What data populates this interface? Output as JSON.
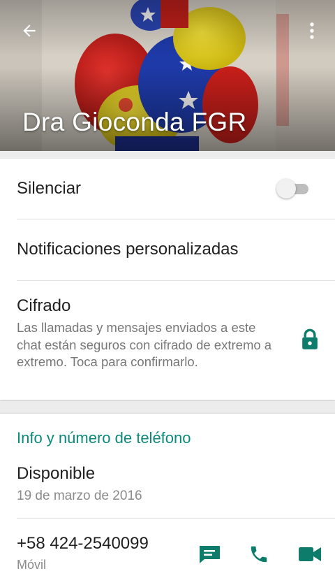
{
  "header": {
    "contact_name": "Dra Gioconda FGR",
    "back_icon": "arrow-back-icon",
    "menu_icon": "more-vert-icon"
  },
  "settings": {
    "mute_label": "Silenciar",
    "mute_enabled": false,
    "custom_notifications_label": "Notificaciones personalizadas",
    "encryption_label": "Cifrado",
    "encryption_description": "Las llamadas y mensajes enviados a este chat están seguros con cifrado de extremo a extremo. Toca para confirmarlo.",
    "encryption_icon": "lock-icon"
  },
  "info": {
    "section_title": "Info y número de teléfono",
    "about": "Disponible",
    "about_date": "19 de marzo de 2016",
    "phone_number": "+58 424-2540099",
    "phone_type": "Móvil",
    "actions": [
      {
        "icon": "message-icon"
      },
      {
        "icon": "phone-icon"
      },
      {
        "icon": "video-icon"
      }
    ]
  },
  "colors": {
    "accent": "#0a8a79",
    "icon_green": "#0e7c6b"
  }
}
